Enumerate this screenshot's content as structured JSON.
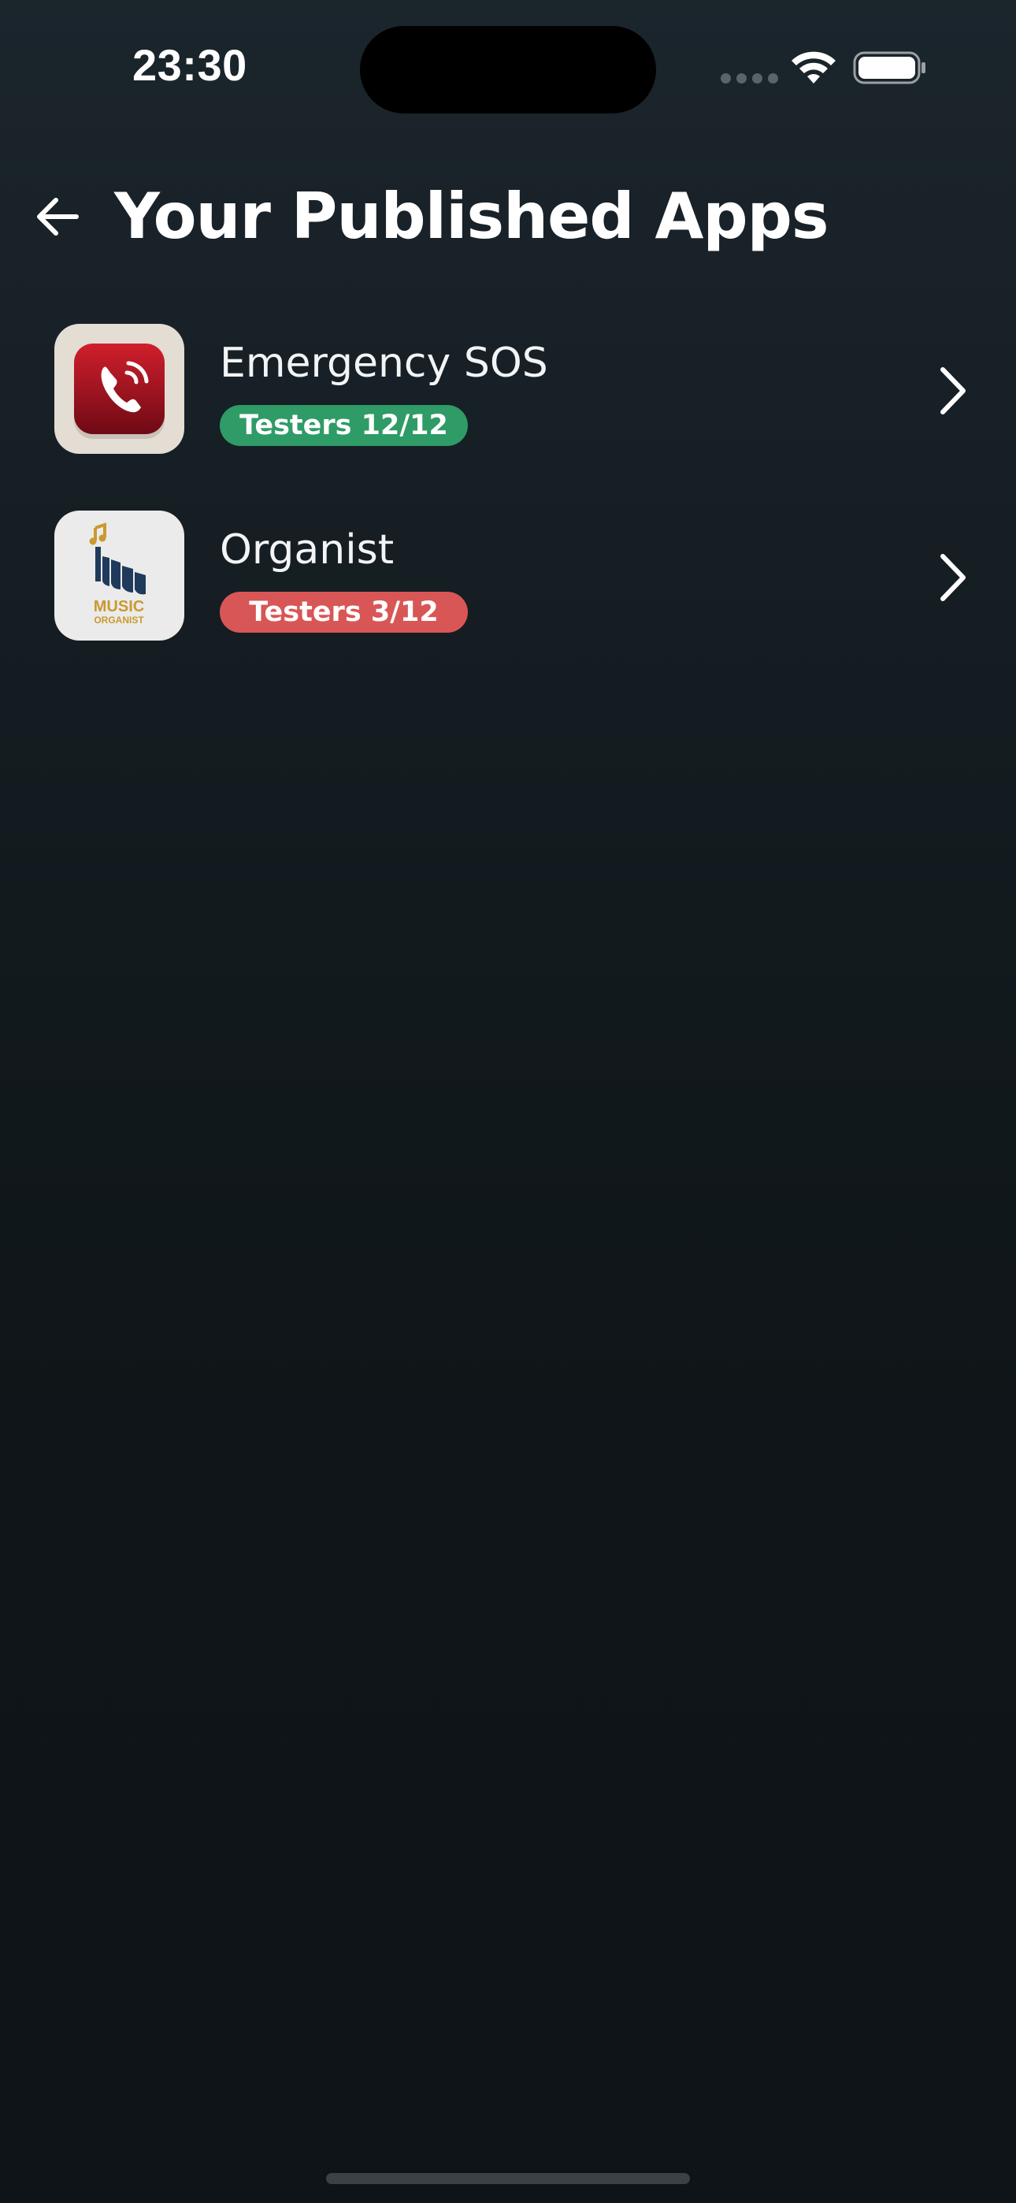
{
  "status_bar": {
    "time": "23:30"
  },
  "header": {
    "back_icon": "arrow-left-icon",
    "title": "Your Published Apps"
  },
  "apps": [
    {
      "name": "Emergency SOS",
      "icon": "phone-icon",
      "badge": "Testers 12/12",
      "badge_color": "#2f9b66"
    },
    {
      "name": "Organist",
      "icon": "music-organist-logo",
      "icon_text_1": "MUSIC",
      "icon_text_2": "ORGANIST",
      "badge": "Testers 3/12",
      "badge_color": "#d95656"
    }
  ],
  "colors": {
    "background": "#141c21",
    "accent_green": "#2f9b66",
    "accent_red": "#d95656"
  }
}
